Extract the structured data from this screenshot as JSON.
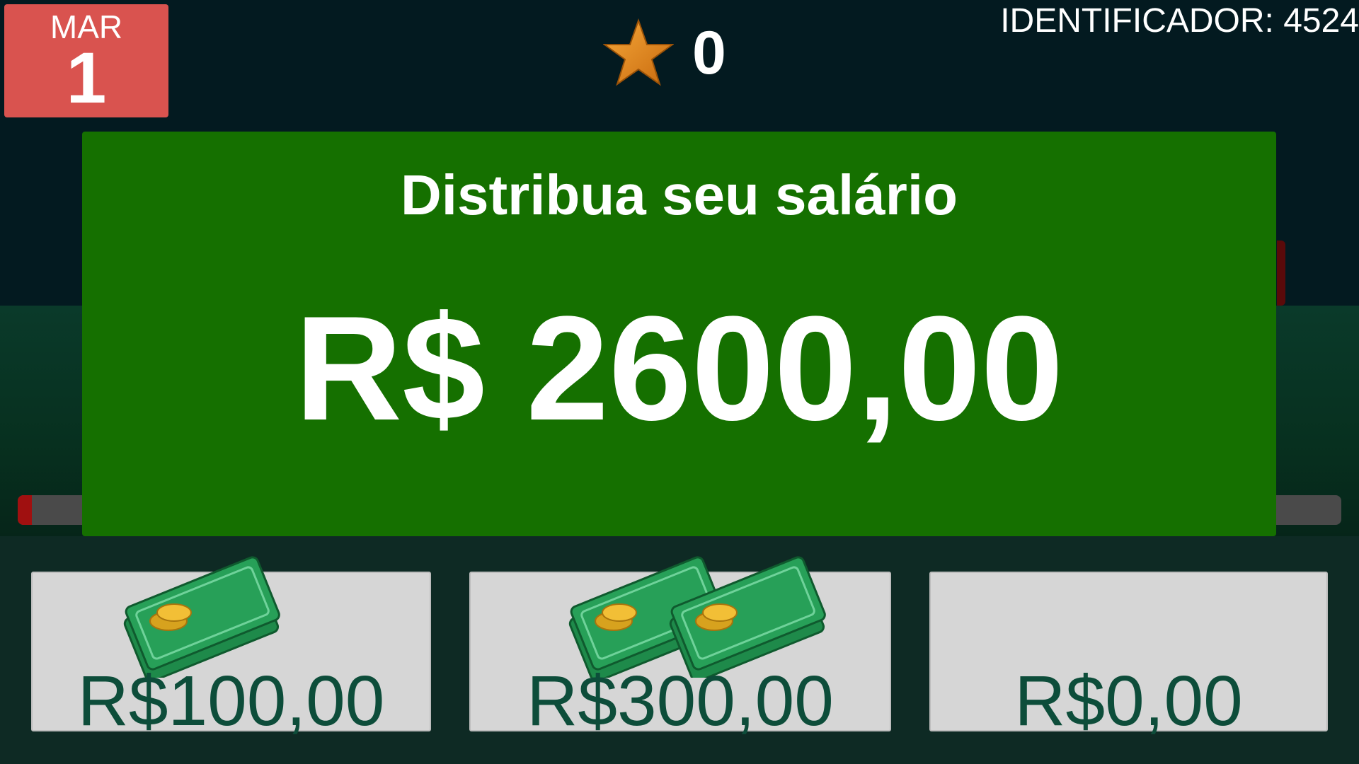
{
  "calendar": {
    "month": "MAR",
    "day": "1"
  },
  "score": {
    "value": "0",
    "icon": "star-icon"
  },
  "identifier": {
    "label": "IDENTIFICADOR:",
    "value": "4524"
  },
  "modal": {
    "title": "Distribua seu salário",
    "amount": "R$ 2600,00"
  },
  "options": [
    {
      "label": "R$100,00",
      "money_stacks": 1
    },
    {
      "label": "R$300,00",
      "money_stacks": 2
    },
    {
      "label": "R$0,00",
      "money_stacks": 0
    }
  ],
  "colors": {
    "background": "#031a20",
    "calendar": "#d9534f",
    "modal": "#157000",
    "option_card": "#d6d6d6",
    "option_text": "#0d4d3a",
    "star": "#e08a1e"
  }
}
